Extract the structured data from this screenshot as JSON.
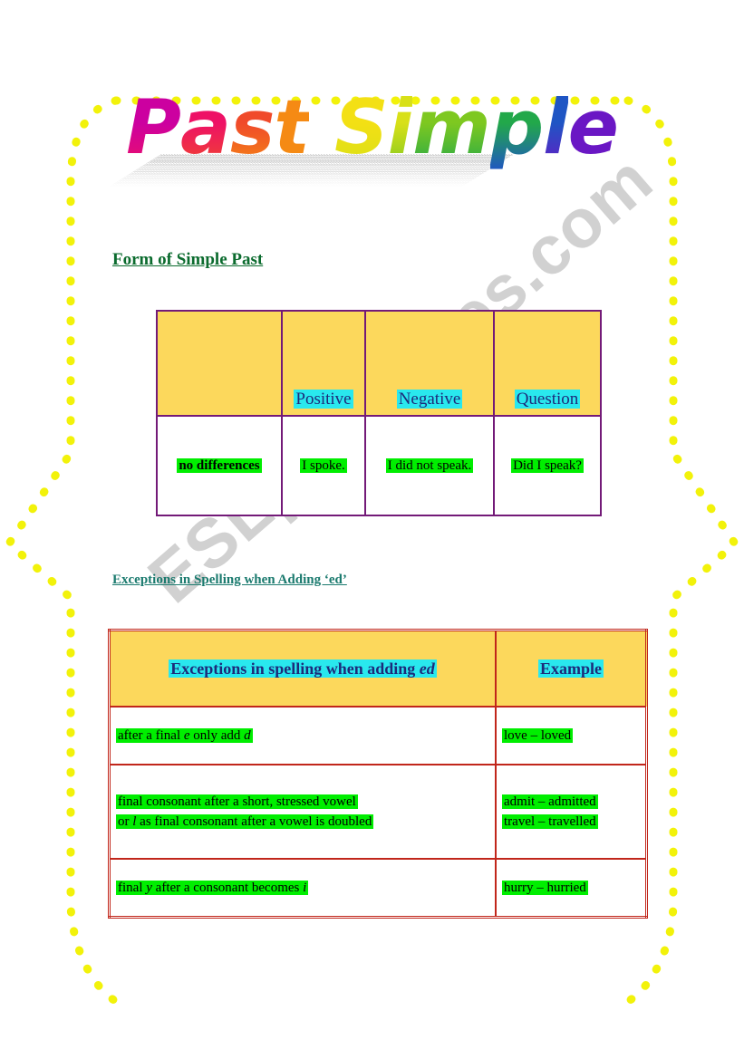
{
  "page": {
    "title_text": "Past Simple",
    "watermark": "ESLprintables.com",
    "colors": {
      "frame_dot": "#f2f20a",
      "table1_border": "#731a78",
      "table2_border": "#c1261b",
      "header_fill": "#fcd85c",
      "cyan_highlight": "#29e8ee",
      "green_highlight": "#00ee00",
      "heading_green": "#0b6b2e",
      "heading_teal": "#1a7a6e",
      "watermark_grey": "#c9c9c9"
    },
    "title_letters": [
      {
        "char": "P",
        "color": "#cc00a0"
      },
      {
        "char": "a",
        "color": "#ee1166"
      },
      {
        "char": "s",
        "color": "#f04a2a"
      },
      {
        "char": "t",
        "color": "#f58a14"
      },
      {
        "char": " ",
        "color": "#ffffff"
      },
      {
        "char": "S",
        "color": "#f3e014"
      },
      {
        "char": "i",
        "color": "#d8e018"
      },
      {
        "char": "m",
        "color": "#7ec820"
      },
      {
        "char": "p",
        "color": "#22a84a"
      },
      {
        "char": "l",
        "color": "#1f55c4"
      },
      {
        "char": "e",
        "color": "#6a17c4"
      }
    ]
  },
  "headings": {
    "form": "Form of Simple Past",
    "exceptions": "Exceptions in Spelling when Adding ‘ed’"
  },
  "table_form": {
    "columns": [
      "",
      "Positive",
      "Negative",
      "Question"
    ],
    "row": [
      "no differences",
      "I spoke.",
      "I did not speak.",
      "Did I speak?"
    ]
  },
  "table_exceptions": {
    "columns": [
      "Exceptions in spelling when adding ",
      "Example"
    ],
    "column_header_italic_suffix": "ed",
    "rows": [
      {
        "rule_lines": [
          {
            "pre": "after a final ",
            "it1": "e",
            "mid": " only add ",
            "it2": "d",
            "post": ""
          }
        ],
        "examples": [
          "love – loved"
        ]
      },
      {
        "rule_lines": [
          {
            "pre": "final consonant after a short, stressed vowel",
            "it1": "",
            "mid": "",
            "it2": "",
            "post": ""
          },
          {
            "pre": "or ",
            "it1": "l",
            "mid": " as final consonant after a vowel is doubled",
            "it2": "",
            "post": ""
          }
        ],
        "examples": [
          "admit – admitted",
          "travel – travelled"
        ]
      },
      {
        "rule_lines": [
          {
            "pre": "final ",
            "it1": "y",
            "mid": " after a consonant becomes ",
            "it2": "i",
            "post": ""
          }
        ],
        "examples": [
          "hurry – hurried"
        ]
      }
    ]
  }
}
